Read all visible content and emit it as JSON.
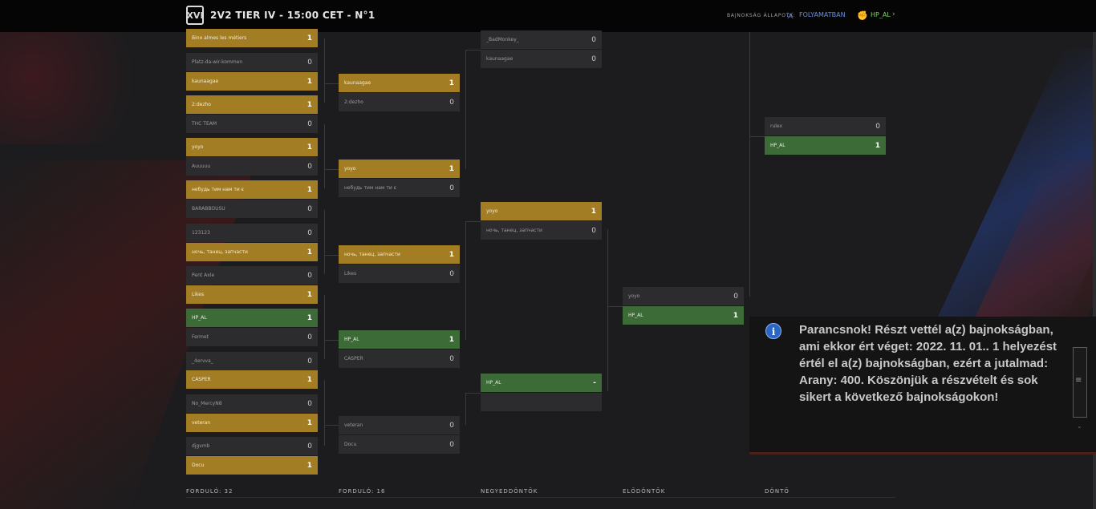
{
  "header": {
    "logo_text": "XVI",
    "title": "2V2 TIER IV - 15:00 CET - N°1",
    "status_label": "BAJNOKSÁG ÁLLAPOTA:",
    "status_value": "FOLYAMATBAN",
    "user_name": "HP_AL",
    "chevron": "›"
  },
  "icons": {
    "logo": "tournament-logo-icon",
    "status": "crossed-swords-icon",
    "user": "fist-icon",
    "info": "info-icon"
  },
  "colors": {
    "winner": "#a37d23",
    "player": "#3d6b38",
    "loser": "#2c2c2f",
    "status": "#6a8fe6",
    "user": "#7ed364"
  },
  "rounds": [
    "FORDULÓ: 32",
    "FORDULÓ: 16",
    "NEGYEDDÖNTŐK",
    "ELŐDÖNTŐK",
    "DÖNTŐ"
  ],
  "r32": [
    [
      [
        "Bino almes les métiers",
        "1",
        "win"
      ],
      [
        "Platz-da-wir-kommen",
        "0",
        "lose"
      ]
    ],
    [
      [
        "kaunaagae",
        "1",
        "win"
      ],
      [
        "2:dezho",
        "1",
        "win"
      ]
    ],
    [
      [
        "THC TEAM",
        "0",
        "lose"
      ],
      [
        "yoyo",
        "1",
        "win"
      ]
    ],
    [
      [
        "Auuuuu",
        "0",
        "lose"
      ],
      [
        "небудь тим нам ти є",
        "1",
        "win"
      ]
    ],
    [
      [
        "BARABBOUSU",
        "0",
        "lose"
      ],
      [
        "123123",
        "0",
        "lose"
      ]
    ],
    [
      [
        "ночь, танец, запчасти",
        "1",
        "win"
      ],
      [
        "Pent Axle",
        "0",
        "lose"
      ]
    ],
    [
      [
        "Likes",
        "1",
        "win"
      ],
      [
        "HP_AL",
        "1",
        "green"
      ]
    ],
    [
      [
        "Fermet",
        "0",
        "lose"
      ],
      [
        "_4ervva_",
        "0",
        "lose"
      ]
    ],
    [
      [
        "CASPER",
        "1",
        "win"
      ],
      [
        "No_MercyN8",
        "0",
        "lose"
      ]
    ],
    [
      [
        "veteran",
        "1",
        "win"
      ],
      [
        "djgvmb",
        "0",
        "lose"
      ]
    ],
    [
      [
        "Docu",
        "1",
        "win"
      ]
    ]
  ],
  "r16": [
    [
      [
        "kaunaagae",
        "1",
        "win"
      ],
      [
        "2:dezho",
        "0",
        "lose"
      ]
    ],
    [
      [
        "yoyo",
        "1",
        "win"
      ],
      [
        "небудь тим нам ти є",
        "0",
        "lose"
      ]
    ],
    [
      [
        "ночь, танец, запчасти",
        "1",
        "win"
      ],
      [
        "Likes",
        "0",
        "lose"
      ]
    ],
    [
      [
        "HP_AL",
        "1",
        "green"
      ],
      [
        "CASPER",
        "0",
        "lose"
      ]
    ],
    [
      [
        "veteran",
        "0",
        "lose"
      ],
      [
        "Docu",
        "0",
        "lose"
      ]
    ]
  ],
  "qf": [
    [
      [
        "_BadMonkey_",
        "0",
        "lose"
      ],
      [
        "kaunaagae",
        "0",
        "lose"
      ]
    ],
    [
      [
        "yoyo",
        "1",
        "win"
      ],
      [
        "ночь, танец, запчасти",
        "0",
        "lose"
      ]
    ],
    [
      [
        "HP_AL",
        "-",
        "green"
      ],
      [
        "",
        "",
        "empty"
      ]
    ]
  ],
  "sf": [
    [
      [
        "yoyo",
        "0",
        "lose"
      ],
      [
        "HP_AL",
        "1",
        "green"
      ]
    ]
  ],
  "final": [
    [
      [
        "rulex",
        "0",
        "lose"
      ],
      [
        "HP_AL",
        "1",
        "green"
      ]
    ]
  ],
  "notification": {
    "text": "Parancsnok! Részt vettél a(z) bajnokságban, ami ekkor ért véget: 2022. 11. 01.. 1 helyezést értél el a(z) bajnokságban, ezért a jutalmad: Arany: 400. Köszönjük a részvételt és sok sikert a következő bajnokságokon!",
    "icon_glyph": "i",
    "grip": "≡",
    "down_arrow": "⌄"
  }
}
